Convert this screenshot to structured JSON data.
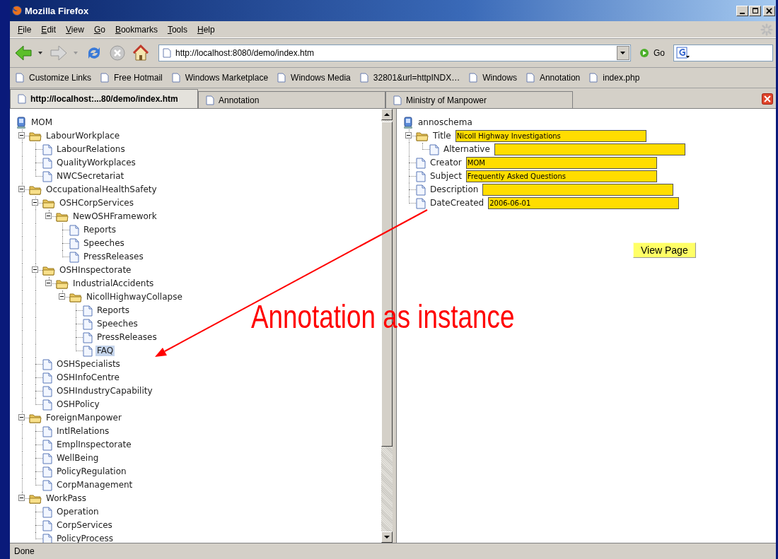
{
  "window": {
    "title": "Mozilla Firefox"
  },
  "menu": [
    "File",
    "Edit",
    "View",
    "Go",
    "Bookmarks",
    "Tools",
    "Help"
  ],
  "address": {
    "url": "http://localhost:8080/demo/index.htm",
    "go_label": "Go"
  },
  "bookmarks": [
    "Customize Links",
    "Free Hotmail",
    "Windows Marketplace",
    "Windows Media",
    "32801&url=httpINDX…",
    "Windows",
    "Annotation",
    "index.php"
  ],
  "tabs": [
    {
      "label": "http://localhost:...80/demo/index.htm",
      "selected": true
    },
    {
      "label": "Annotation",
      "selected": false
    },
    {
      "label": "Ministry of Manpower",
      "selected": false
    }
  ],
  "nav_tree": {
    "label": "MOM",
    "children": [
      {
        "label": "LabourWorkplace",
        "kind": "folder",
        "expanded": true,
        "selected": false,
        "children": [
          {
            "label": "LabourRelations",
            "kind": "page",
            "selected": false
          },
          {
            "label": "QualityWorkplaces",
            "kind": "page",
            "selected": false
          },
          {
            "label": "NWCSecretariat",
            "kind": "page",
            "selected": false
          }
        ]
      },
      {
        "label": "OccupationalHealthSafety",
        "kind": "folder",
        "expanded": true,
        "selected": false,
        "children": [
          {
            "label": "OSHCorpServices",
            "kind": "folder",
            "expanded": true,
            "selected": false,
            "children": [
              {
                "label": "NewOSHFramework",
                "kind": "folder",
                "expanded": true,
                "selected": false,
                "children": [
                  {
                    "label": "Reports",
                    "kind": "page",
                    "selected": false
                  },
                  {
                    "label": "Speeches",
                    "kind": "page",
                    "selected": false
                  },
                  {
                    "label": "PressReleases",
                    "kind": "page",
                    "selected": false
                  }
                ]
              }
            ]
          },
          {
            "label": "OSHInspectorate",
            "kind": "folder",
            "expanded": true,
            "selected": false,
            "children": [
              {
                "label": "IndustrialAccidents",
                "kind": "folder",
                "expanded": true,
                "selected": false,
                "children": [
                  {
                    "label": "NicollHighwayCollapse",
                    "kind": "folder",
                    "expanded": true,
                    "selected": false,
                    "children": [
                      {
                        "label": "Reports",
                        "kind": "page",
                        "selected": false
                      },
                      {
                        "label": "Speeches",
                        "kind": "page",
                        "selected": false
                      },
                      {
                        "label": "PressReleases",
                        "kind": "page",
                        "selected": false
                      },
                      {
                        "label": "FAQ",
                        "kind": "page",
                        "selected": true
                      }
                    ]
                  }
                ]
              }
            ]
          },
          {
            "label": "OSHSpecialists",
            "kind": "page",
            "selected": false
          },
          {
            "label": "OSHInfoCentre",
            "kind": "page",
            "selected": false
          },
          {
            "label": "OSHIndustryCapability",
            "kind": "page",
            "selected": false
          },
          {
            "label": "OSHPolicy",
            "kind": "page",
            "selected": false
          }
        ]
      },
      {
        "label": "ForeignManpower",
        "kind": "folder",
        "expanded": true,
        "selected": false,
        "children": [
          {
            "label": "IntlRelations",
            "kind": "page",
            "selected": false
          },
          {
            "label": "EmplInspectorate",
            "kind": "page",
            "selected": false
          },
          {
            "label": "WellBeing",
            "kind": "page",
            "selected": false
          },
          {
            "label": "PolicyRegulation",
            "kind": "page",
            "selected": false
          },
          {
            "label": "CorpManagement",
            "kind": "page",
            "selected": false
          }
        ]
      },
      {
        "label": "WorkPass",
        "kind": "folder",
        "expanded": true,
        "selected": false,
        "children": [
          {
            "label": "Operation",
            "kind": "page",
            "selected": false
          },
          {
            "label": "CorpServices",
            "kind": "page",
            "selected": false
          },
          {
            "label": "PolicyProcess",
            "kind": "page",
            "selected": false
          }
        ]
      }
    ]
  },
  "schema": {
    "label": "annoschema",
    "children": [
      {
        "label": "Title",
        "kind": "folder",
        "expanded": true,
        "value": "Nicoll Highway Investigations",
        "children": [
          {
            "label": "Alternative",
            "kind": "page"
          }
        ]
      },
      {
        "label": "Creator",
        "kind": "page",
        "value": "MOM"
      },
      {
        "label": "Subject",
        "kind": "page",
        "value": "Frequently Asked Questions"
      },
      {
        "label": "Description",
        "kind": "page"
      },
      {
        "label": "DateCreated",
        "kind": "page",
        "value": "2006-06-01"
      }
    ]
  },
  "view_button": "View Page",
  "annotation": "Annotation as instance",
  "status_bar": "Done"
}
